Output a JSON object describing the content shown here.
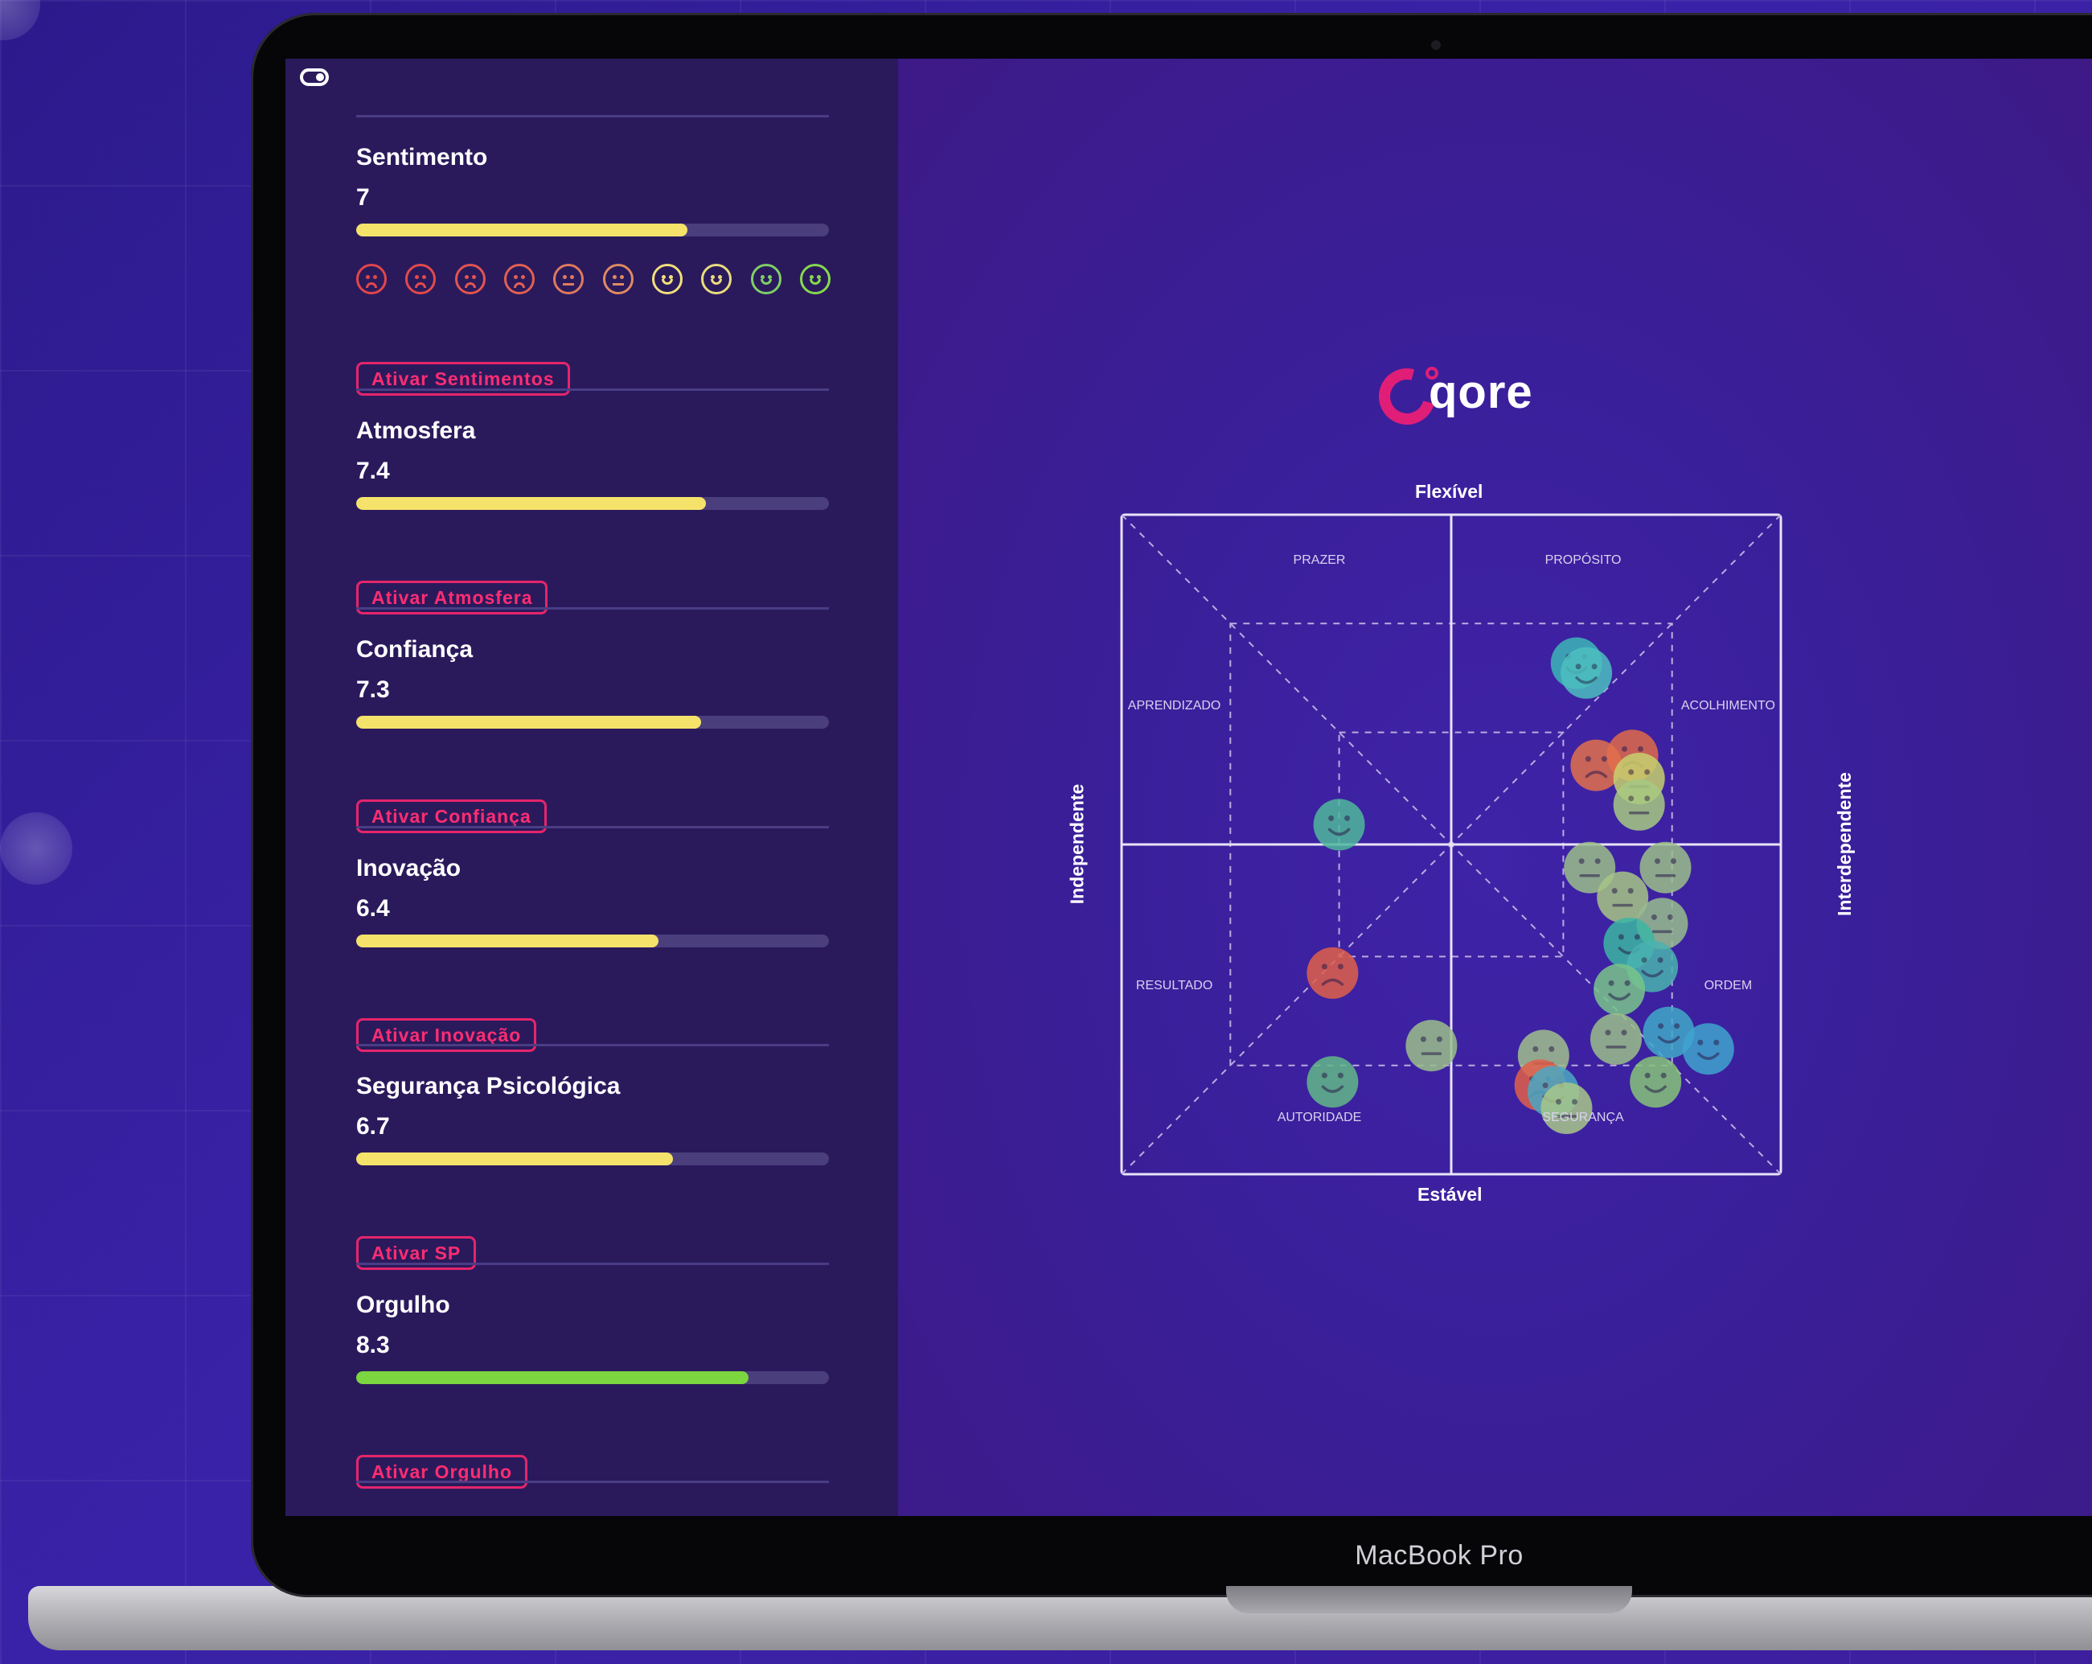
{
  "device": {
    "label": "MacBook Pro"
  },
  "sidebar": {
    "metrics": [
      {
        "title": "Sentimento",
        "value": "7",
        "fraction": 0.7,
        "color": "#f5e26a",
        "button": "Ativar Sentimentos"
      },
      {
        "title": "Atmosfera",
        "value": "7.4",
        "fraction": 0.74,
        "color": "#f5e26a",
        "button": "Ativar Atmosfera"
      },
      {
        "title": "Confiança",
        "value": "7.3",
        "fraction": 0.73,
        "color": "#f5e26a",
        "button": "Ativar Confiança"
      },
      {
        "title": "Inovação",
        "value": "6.4",
        "fraction": 0.64,
        "color": "#f5e26a",
        "button": "Ativar Inovação"
      },
      {
        "title": "Segurança Psicológica",
        "value": "6.7",
        "fraction": 0.67,
        "color": "#f5e26a",
        "button": "Ativar SP"
      },
      {
        "title": "Orgulho",
        "value": "8.3",
        "fraction": 0.83,
        "color": "#7bd63f",
        "button": "Ativar Orgulho"
      }
    ],
    "sentiment_scale": [
      {
        "icon": "very-sad-face-icon",
        "mood": "sad",
        "color": "#e2474a"
      },
      {
        "icon": "very-sad-face-icon",
        "mood": "sad",
        "color": "#e34a4a"
      },
      {
        "icon": "sad-face-icon",
        "mood": "sad",
        "color": "#e35550"
      },
      {
        "icon": "sad-face-icon",
        "mood": "sad",
        "color": "#e35f52"
      },
      {
        "icon": "neutral-face-icon",
        "mood": "neutral",
        "color": "#e07a5c"
      },
      {
        "icon": "neutral-face-icon",
        "mood": "neutral",
        "color": "#e08a62"
      },
      {
        "icon": "slight-smile-face-icon",
        "mood": "happy",
        "color": "#f2e07a"
      },
      {
        "icon": "slight-smile-face-icon",
        "mood": "happy",
        "color": "#e9dc7e"
      },
      {
        "icon": "happy-face-icon",
        "mood": "happy",
        "color": "#7fcf66"
      },
      {
        "icon": "big-smile-face-icon",
        "mood": "happy",
        "color": "#86d94e"
      }
    ]
  },
  "brand": {
    "logo_text": "qore",
    "accent": "#e01e78"
  },
  "chart_data": {
    "type": "scatter",
    "title": "",
    "axes": {
      "top": "Flexível",
      "bottom": "Estável",
      "left": "Independente",
      "right": "Interdependente"
    },
    "xlim": [
      -1,
      1
    ],
    "ylim": [
      -1,
      1
    ],
    "regions": [
      {
        "label": "PRAZER",
        "x": -0.4,
        "y": 0.86
      },
      {
        "label": "PROPÓSITO",
        "x": 0.4,
        "y": 0.86
      },
      {
        "label": "APRENDIZADO",
        "x": -0.84,
        "y": 0.42
      },
      {
        "label": "ACOLHIMENTO",
        "x": 0.84,
        "y": 0.42
      },
      {
        "label": "RESULTADO",
        "x": -0.84,
        "y": -0.43
      },
      {
        "label": "ORDEM",
        "x": 0.84,
        "y": -0.43
      },
      {
        "label": "AUTORIDADE",
        "x": -0.4,
        "y": -0.83
      },
      {
        "label": "SEGURANÇA",
        "x": 0.4,
        "y": -0.83
      }
    ],
    "points": [
      {
        "x": 0.38,
        "y": 0.55,
        "mood": "happy",
        "color": "#3cb6b8"
      },
      {
        "x": 0.41,
        "y": 0.52,
        "mood": "happy",
        "color": "#4dbfc0"
      },
      {
        "x": 0.55,
        "y": 0.27,
        "mood": "sad",
        "color": "#e06a4a"
      },
      {
        "x": 0.44,
        "y": 0.24,
        "mood": "sad",
        "color": "#e2704c"
      },
      {
        "x": 0.57,
        "y": 0.2,
        "mood": "neutral",
        "color": "#c7d16e"
      },
      {
        "x": 0.57,
        "y": 0.12,
        "mood": "neutral",
        "color": "#a8c982"
      },
      {
        "x": -0.34,
        "y": 0.06,
        "mood": "happy",
        "color": "#4fb89c"
      },
      {
        "x": 0.42,
        "y": -0.07,
        "mood": "neutral",
        "color": "#9bbf8a"
      },
      {
        "x": 0.65,
        "y": -0.07,
        "mood": "neutral",
        "color": "#9bbf8a"
      },
      {
        "x": 0.52,
        "y": -0.16,
        "mood": "neutral",
        "color": "#a7c585"
      },
      {
        "x": 0.64,
        "y": -0.24,
        "mood": "neutral",
        "color": "#98bd8e"
      },
      {
        "x": 0.54,
        "y": -0.3,
        "mood": "happy",
        "color": "#3cb6a4"
      },
      {
        "x": 0.61,
        "y": -0.37,
        "mood": "happy",
        "color": "#4ab3b0"
      },
      {
        "x": 0.51,
        "y": -0.44,
        "mood": "happy",
        "color": "#79c58a"
      },
      {
        "x": -0.36,
        "y": -0.39,
        "mood": "sad",
        "color": "#e0604a"
      },
      {
        "x": 0.5,
        "y": -0.59,
        "mood": "neutral",
        "color": "#9abf8a"
      },
      {
        "x": 0.66,
        "y": -0.57,
        "mood": "happy",
        "color": "#41a9c9"
      },
      {
        "x": 0.78,
        "y": -0.62,
        "mood": "happy",
        "color": "#3fa4cf"
      },
      {
        "x": -0.06,
        "y": -0.61,
        "mood": "neutral",
        "color": "#9abf8a"
      },
      {
        "x": 0.28,
        "y": -0.64,
        "mood": "neutral",
        "color": "#a1bf8c"
      },
      {
        "x": 0.62,
        "y": -0.72,
        "mood": "happy",
        "color": "#86c47a"
      },
      {
        "x": -0.36,
        "y": -0.72,
        "mood": "happy",
        "color": "#62b888"
      },
      {
        "x": 0.27,
        "y": -0.73,
        "mood": "sad",
        "color": "#e2604a"
      },
      {
        "x": 0.31,
        "y": -0.75,
        "mood": "happy",
        "color": "#4aa9c4"
      },
      {
        "x": 0.35,
        "y": -0.8,
        "mood": "neutral",
        "color": "#a9c78a"
      }
    ]
  }
}
